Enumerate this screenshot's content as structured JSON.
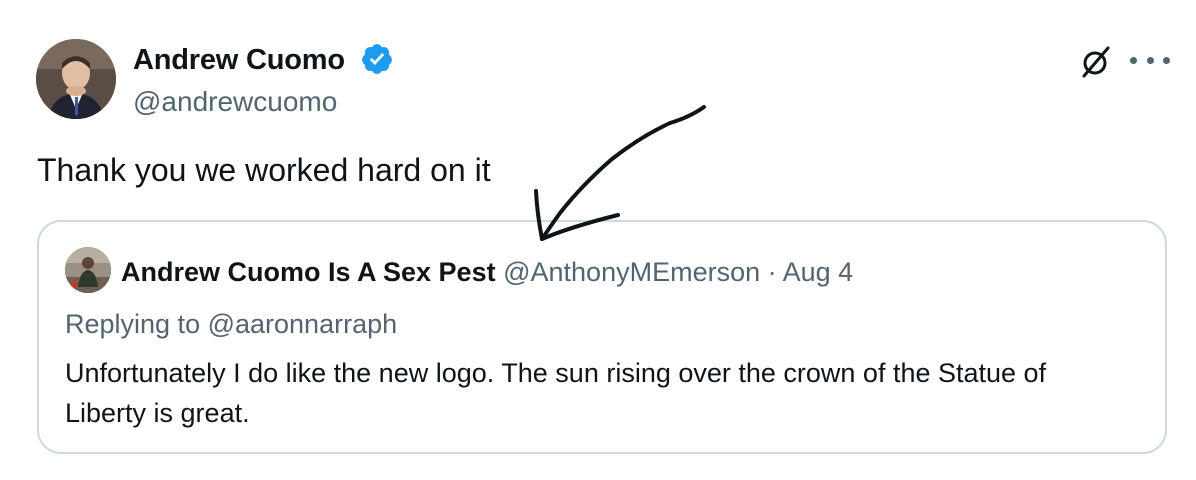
{
  "tweet": {
    "author_name": "Andrew Cuomo",
    "author_handle": "@andrewcuomo",
    "text": "Thank you we worked hard on it",
    "icons": {
      "verified": "verified-badge-icon",
      "grok": "grok-icon",
      "more": "more-options-icon"
    },
    "colors": {
      "verified": "#1d9bf0",
      "secondary_text": "#536471",
      "border": "#cfd9de"
    }
  },
  "quote": {
    "author_name": "Andrew Cuomo Is A Sex Pest",
    "author_handle": "@AnthonyMEmerson",
    "separator": " · ",
    "date": "Aug 4",
    "replying_prefix": "Replying to ",
    "replying_handle": "@aaronnarraph",
    "text": "Unfortunately I do like the new logo. The sun rising over the crown of the Statue of Liberty is great."
  }
}
